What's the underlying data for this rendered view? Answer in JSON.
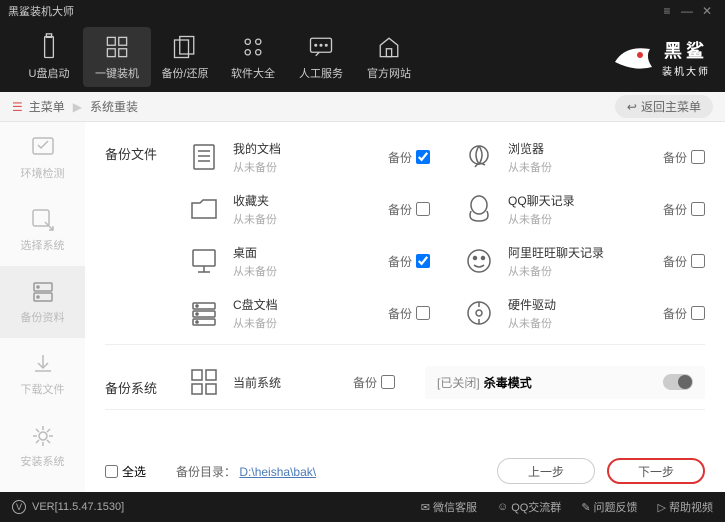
{
  "window": {
    "title": "黑鲨装机大师"
  },
  "topnav": {
    "items": [
      {
        "label": "U盘启动"
      },
      {
        "label": "一键装机"
      },
      {
        "label": "备份/还原"
      },
      {
        "label": "软件大全"
      },
      {
        "label": "人工服务"
      },
      {
        "label": "官方网站"
      }
    ]
  },
  "brand": {
    "big": "黑鲨",
    "small": "装机大师"
  },
  "breadcrumb": {
    "root": "主菜单",
    "current": "系统重装",
    "back": "返回主菜单"
  },
  "sidebar": {
    "items": [
      {
        "label": "环境检测"
      },
      {
        "label": "选择系统"
      },
      {
        "label": "备份资料"
      },
      {
        "label": "下载文件"
      },
      {
        "label": "安装系统"
      }
    ]
  },
  "sections": {
    "files_label": "备份文件",
    "system_label": "备份系统",
    "action_label": "备份",
    "never_backup": "从未备份",
    "files": [
      {
        "name": "我的文档",
        "checked": true
      },
      {
        "name": "浏览器",
        "checked": false
      },
      {
        "name": "收藏夹",
        "checked": false
      },
      {
        "name": "QQ聊天记录",
        "checked": false
      },
      {
        "name": "桌面",
        "checked": true
      },
      {
        "name": "阿里旺旺聊天记录",
        "checked": false
      },
      {
        "name": "C盘文档",
        "checked": false
      },
      {
        "name": "硬件驱动",
        "checked": false
      }
    ],
    "system": {
      "name": "当前系统",
      "checked": false
    },
    "kill_mode": {
      "status": "[已关闭]",
      "label": "杀毒模式"
    }
  },
  "footer": {
    "select_all": "全选",
    "dir_label": "备份目录：",
    "dir_path": "D:\\heisha\\bak\\",
    "prev": "上一步",
    "next": "下一步"
  },
  "statusbar": {
    "version": "VER[11.5.47.1530]",
    "items": [
      {
        "label": "微信客服"
      },
      {
        "label": "QQ交流群"
      },
      {
        "label": "问题反馈"
      },
      {
        "label": "帮助视频"
      }
    ]
  }
}
